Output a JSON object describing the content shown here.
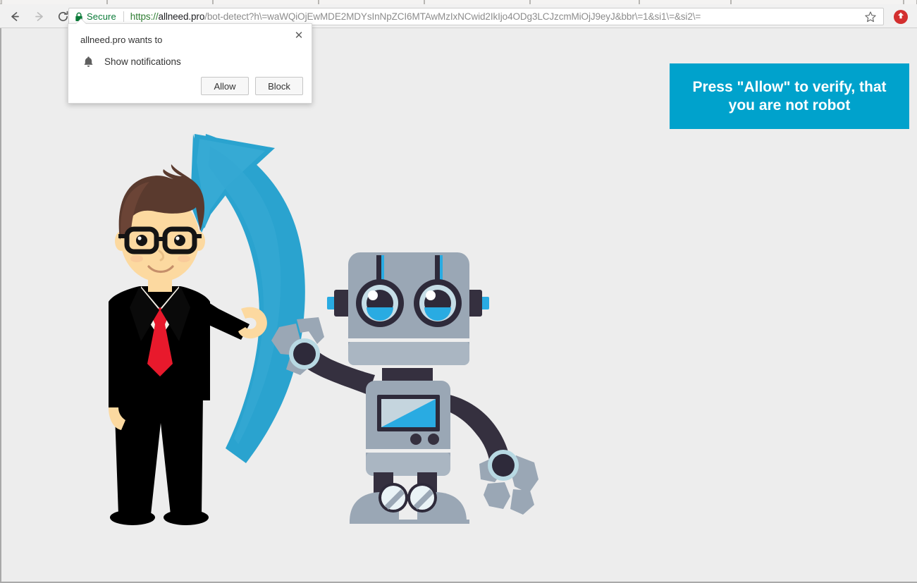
{
  "browser": {
    "nav": {
      "back_label": "Back",
      "forward_label": "Forward",
      "reload_label": "Reload"
    },
    "omnibox": {
      "security_label": "Secure",
      "lock_icon": "green-padlock-icon",
      "url_scheme": "https://",
      "url_host": "allneed.pro",
      "url_rest": "/bot-detect?h\\=waWQiOjEwMDE2MDYsInNpZCI6MTAwMzIxNCwid2IkIjo4ODg3LCJzcmMiOjJ9eyJ&bbr\\=1&si1\\=&si2\\=",
      "full_url": "https://allneed.pro/bot-detect?h\\=waWQiOjEwMDE2MDYsInNpZCI6MTAwMzIxNCwid2IkIjo4ODg3LCJzcmMiOjJ9eyJ&bbr\\=1&si1\\=&si2\\=",
      "bookmark_icon": "star-outline-icon"
    },
    "extension": {
      "icon": "red-circle-up-arrow-icon",
      "label": "Extension"
    }
  },
  "notification_bubble": {
    "title": "allneed.pro wants to",
    "permission_icon": "bell-icon",
    "permission_label": "Show notifications",
    "allow_label": "Allow",
    "block_label": "Block",
    "close_label": "✕"
  },
  "page": {
    "background_color": "#ededed",
    "cta_banner": {
      "text": "Press \"Allow\" to verify, that\nyou are not robot",
      "background_color": "#00a2cc",
      "text_color": "#ffffff"
    },
    "illustration": {
      "name": "man-pointing-arrow-to-robot",
      "man": {
        "name": "businessman-with-glasses",
        "hair_color": "#5a3a2e",
        "skin_color": "#fcd9a0",
        "suit_color": "#000000",
        "shirt_color": "#f5f0e6",
        "tie_color": "#e8192c",
        "glasses_color": "#1a1a1a"
      },
      "arrow": {
        "name": "curved-blue-arrow",
        "color_light": "#2aa3cf",
        "color_dark": "#1187b8"
      },
      "robot": {
        "name": "grey-robot",
        "body_color": "#9aa7b5",
        "body_light": "#aab6c2",
        "dark_color": "#2e2a3a",
        "accent_blue": "#29abe2",
        "eye_light": "#c5dde6",
        "screen_blue": "#29abe2",
        "screen_light": "#c5d5de"
      }
    }
  }
}
